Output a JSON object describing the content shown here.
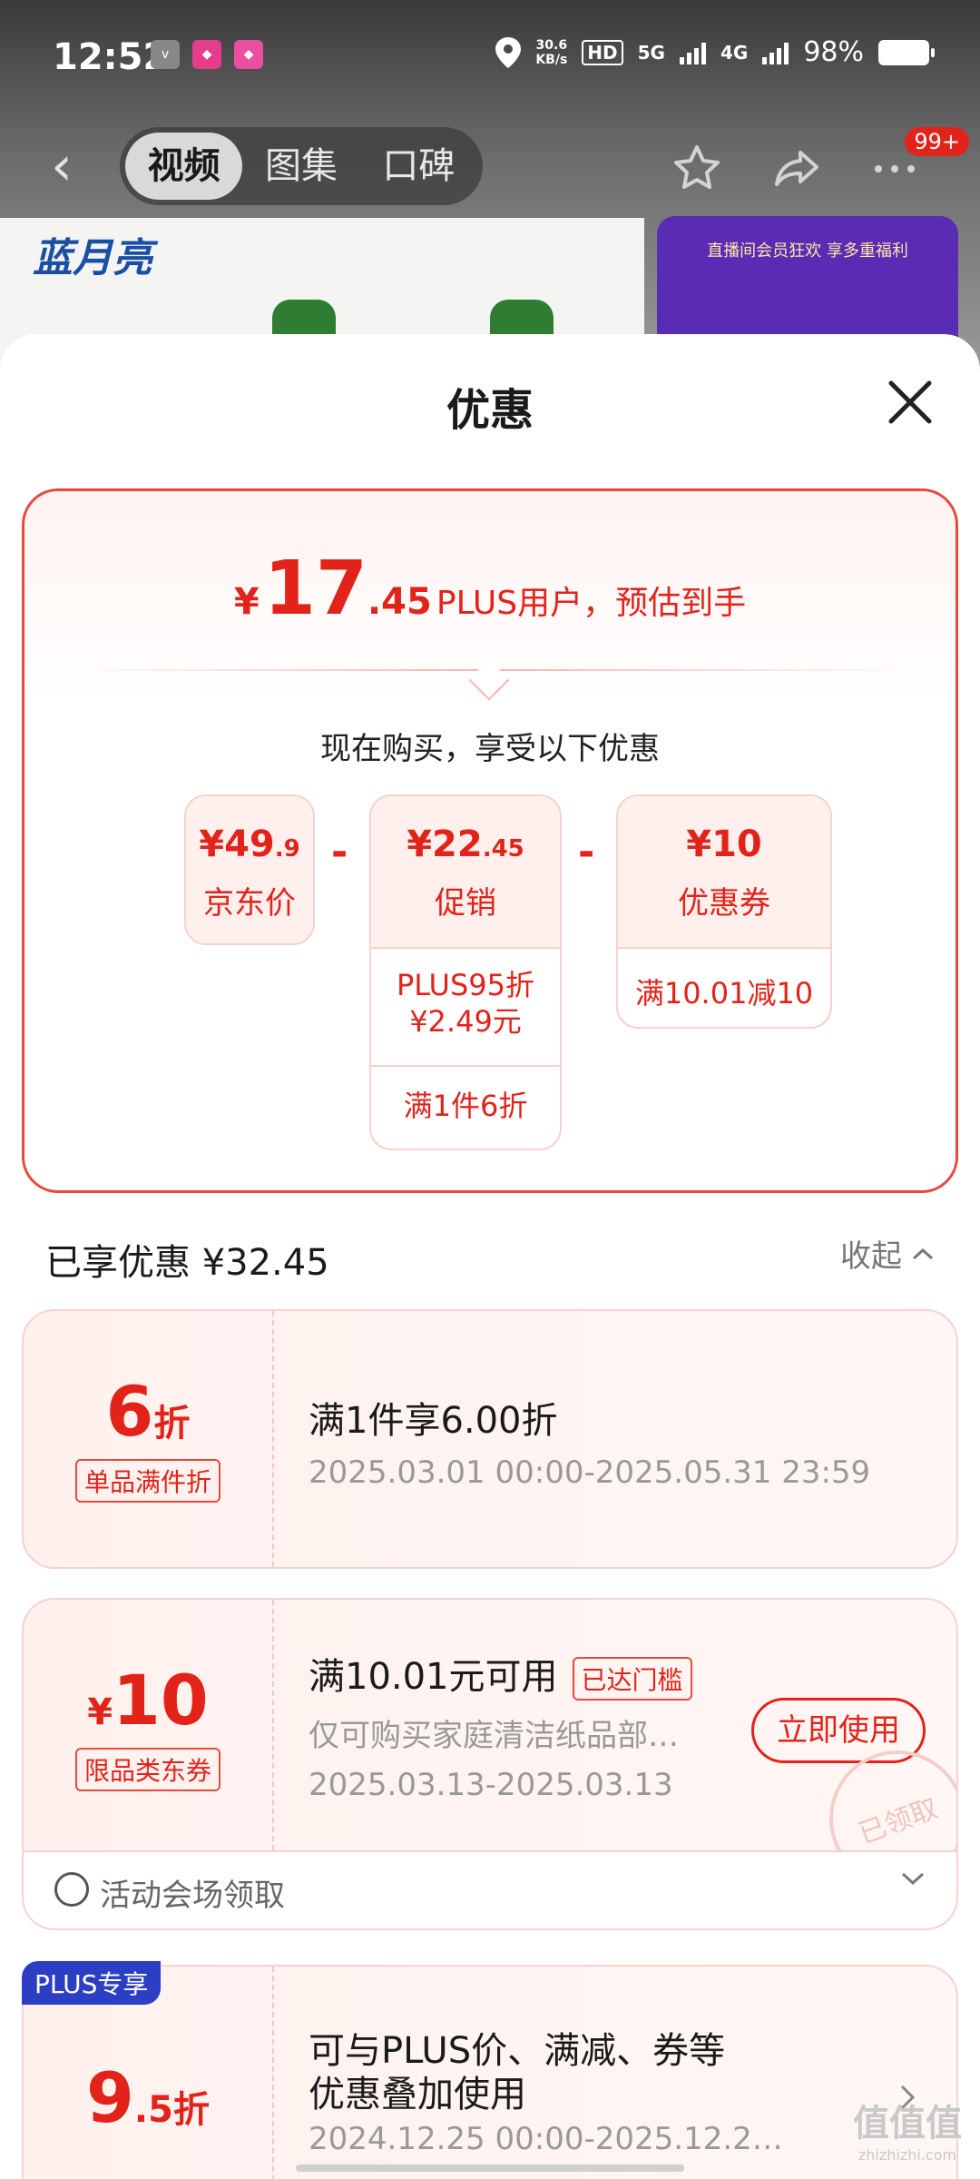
{
  "status_bar": {
    "time": "12:52",
    "speed": "30.6",
    "speed_unit": "KB/s",
    "hd": "HD",
    "net5g": "5G",
    "net4g": "4G",
    "battery": "98%"
  },
  "nav": {
    "tabs": [
      "视频",
      "图集",
      "口碑"
    ],
    "active_tab": 0,
    "badge": "99+"
  },
  "background": {
    "brand": "蓝月亮",
    "live_card_text": "直播间会员狂欢 享多重福利"
  },
  "sheet": {
    "title": "优惠",
    "summary": {
      "currency": "¥",
      "price_int": "17",
      "price_dec": ".45",
      "price_text": "PLUS用户，预估到手",
      "buy_now": "现在购买，享受以下优惠",
      "items": [
        {
          "amount": "¥49",
          "amount_small": ".9",
          "label": "京东价",
          "details": []
        },
        {
          "amount": "¥22",
          "amount_small": ".45",
          "label": "促销",
          "details": [
            "PLUS95折\n¥2.49元",
            "满1件6折"
          ]
        },
        {
          "amount": "¥10",
          "amount_small": "",
          "label": "优惠券",
          "details": [
            "满10.01减10"
          ]
        }
      ],
      "operator": "-"
    },
    "enjoyed": "已享优惠 ¥32.45",
    "collapse": "收起",
    "deals": [
      {
        "value_num": "6",
        "value_unit": "折",
        "tag": "单品满件折",
        "title": "满1件享6.00折",
        "sub": "2025.03.01 00:00-2025.05.31 23:59"
      },
      {
        "value_prefix": "¥",
        "value_num": "10",
        "tag": "限品类东券",
        "title": "满10.01元可用",
        "reached": "已达门槛",
        "desc": "仅可购买家庭清洁纸品部…",
        "sub": "2025.03.13-2025.03.13",
        "button": "立即使用",
        "stamp": "已领取",
        "venue": "活动会场领取"
      },
      {
        "plus_tag": "PLUS专享",
        "value_num": "9",
        "value_dec": ".5",
        "value_unit": "折",
        "title_line1": "可与PLUS价、满减、券等",
        "title_line2": "优惠叠加使用",
        "sub": "2024.12.25 00:00-2025.12.2…"
      }
    ]
  },
  "watermark": {
    "main": "值值值",
    "small": "zhizhizhi.com"
  },
  "colors": {
    "accent": "#e2231a",
    "plus_blue": "#2b3ec4"
  }
}
